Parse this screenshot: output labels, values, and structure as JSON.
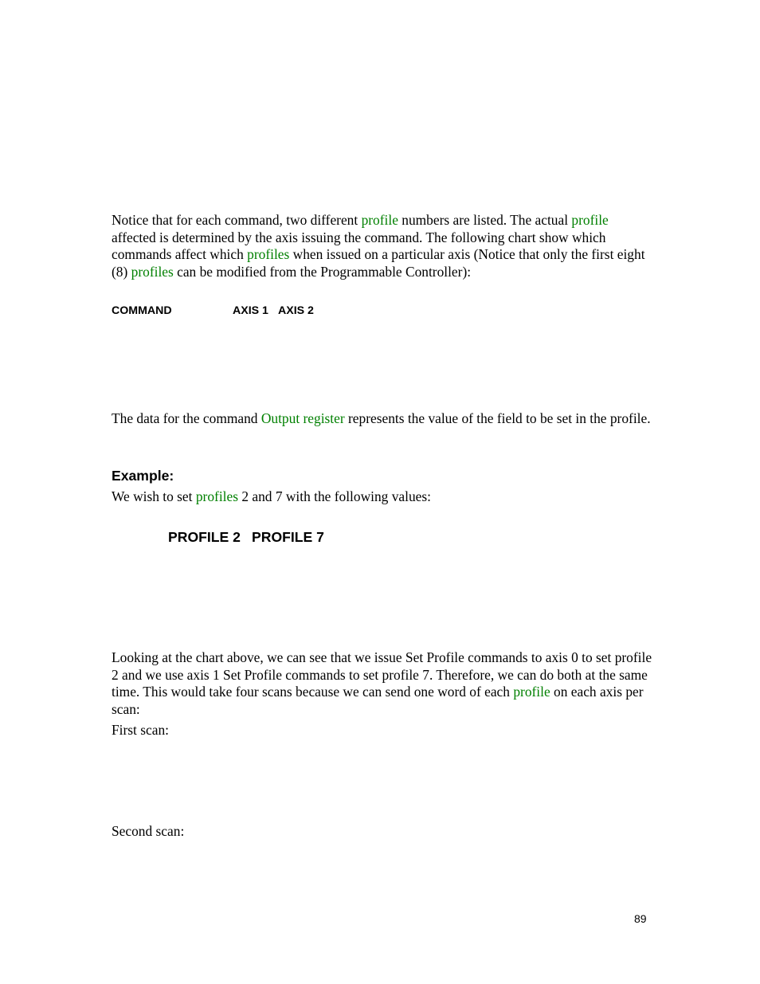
{
  "document": {
    "paragraph1": {
      "t1": "Notice that for each command, two different ",
      "l1": "profile",
      "t2": " numbers are listed.  The actual ",
      "l2": "profile",
      "t3": " affected is determined by the axis issuing the command.  The following chart show which commands affect which ",
      "l3": "profiles",
      "t4": " when issued on a particular axis (Notice that only the first eight (8) ",
      "l4": "profiles",
      "t5": " can be modified from the Programmable Controller):"
    },
    "chart1_headers": {
      "command": "COMMAND",
      "axis1": "AXIS 1",
      "axis2": "AXIS 2"
    },
    "paragraph2": {
      "t1": "The data for the command ",
      "l1": "Output register",
      "t2": " represents the value of the field to be set in the profile."
    },
    "example_heading": "Example:",
    "paragraph3": {
      "t1": "We wish to set ",
      "l1": "profiles",
      "t2": " 2 and 7 with the following values:"
    },
    "chart2_headers": {
      "profile2": "PROFILE 2",
      "profile7": "PROFILE 7"
    },
    "paragraph4": {
      "t1": "Looking at the chart above, we can see that we issue Set Profile commands to axis 0 to set profile 2 and we use axis 1 Set Profile commands to set profile 7.  Therefore, we can do both at the same time.  This would take four scans because we can send one word of each ",
      "l1": "profile",
      "t2": " on each axis per scan:"
    },
    "first_scan": "First scan:",
    "second_scan": "Second scan:",
    "page_number": "89"
  },
  "colors": {
    "link": "#008000",
    "text": "#000000"
  }
}
